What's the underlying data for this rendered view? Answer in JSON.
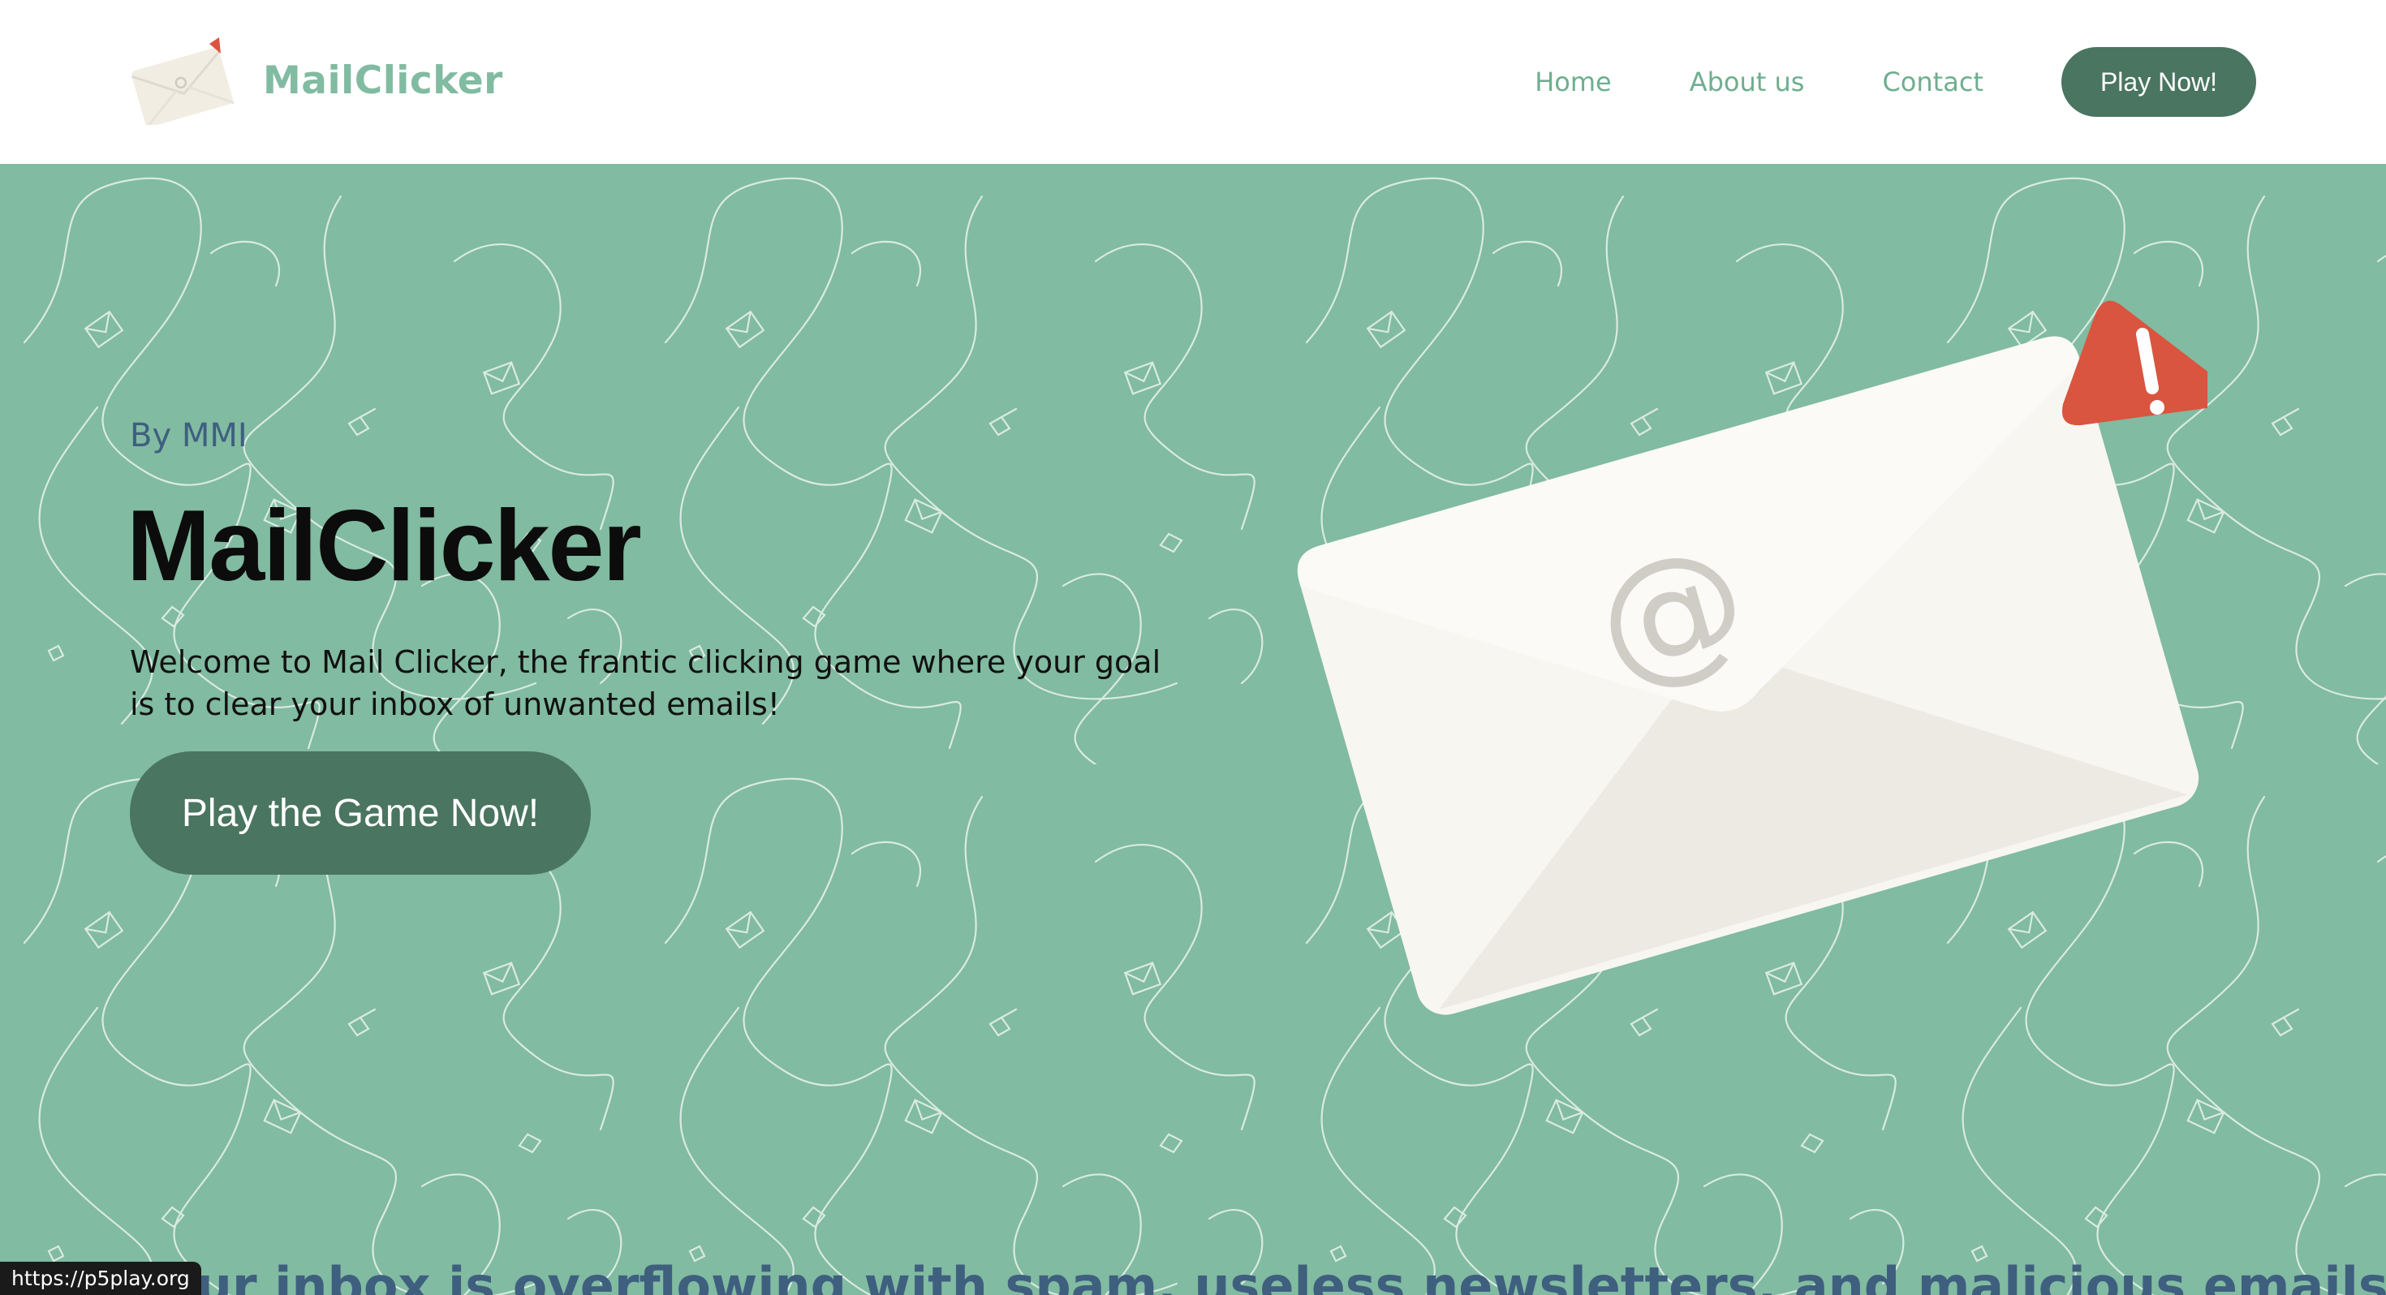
{
  "header": {
    "brand_name": "MailClicker",
    "nav": [
      {
        "label": "Home"
      },
      {
        "label": "About us"
      },
      {
        "label": "Contact"
      }
    ],
    "cta_label": "Play Now!"
  },
  "hero": {
    "byline": "By MMI",
    "title": "MailClicker",
    "description": "Welcome to Mail Clicker, the frantic clicking game where your goal is to clear your inbox of unwanted emails!",
    "cta_label": "Play the Game Now!",
    "teaser": "Your inbox is overflowing with spam, useless newsletters, and malicious emails. Your"
  },
  "status_bar": {
    "url": "https://p5play.org"
  },
  "colors": {
    "brand_green": "#81bba1",
    "dark_green": "#4a7560",
    "alert_red": "#d9553f",
    "envelope_white": "#f8f6f0",
    "byline_blue": "#3f5f7f"
  },
  "icons": {
    "logo": "envelope-logo-icon",
    "hero_illustration": "envelope-alert-icon",
    "background": "envelope-doodle-pattern"
  }
}
